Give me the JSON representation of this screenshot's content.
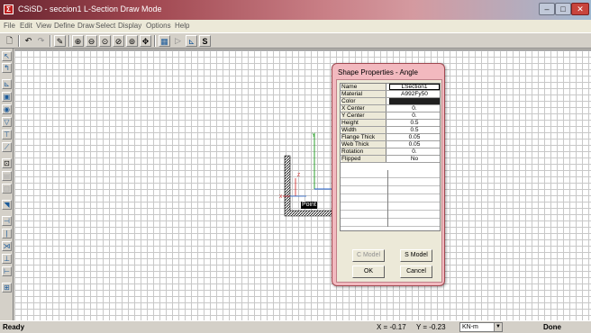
{
  "window": {
    "title": "CSiSD - seccion1  L-Section Draw Mode",
    "app_icon": "csi-app-icon"
  },
  "menu": [
    "File",
    "Edit",
    "View",
    "Define",
    "Draw",
    "Select",
    "Display",
    "Options",
    "Help"
  ],
  "toolbar": {
    "icons": [
      "new-icon",
      "undo-icon",
      "redo-icon",
      "pencil-icon",
      "zoom-in-icon",
      "zoom-out-icon",
      "zoom-window-icon",
      "zoom-previous-icon",
      "zoom-restore-icon",
      "pan-icon",
      "grid-icon",
      "reshape-icon",
      "properties-icon",
      "section-icon"
    ],
    "section_label": "S"
  },
  "left_toolbar": {
    "icons": [
      "pointer-icon",
      "reshape-pointer-icon",
      "draw-polygon-icon",
      "draw-rectangle-icon",
      "draw-circle-icon",
      "draw-triangle-icon",
      "draw-t-shape-icon",
      "draw-line-icon",
      "draw-angle-icon",
      "draw-channel-icon",
      "draw-box-icon",
      "draw-rebar-icon",
      "snap-points-icon",
      "snap-ends-icon",
      "snap-intersection-icon",
      "snap-perpendicular-icon",
      "snap-lines-icon",
      "snap-grid-icon"
    ]
  },
  "dialog": {
    "title": "Shape Properties - Angle",
    "properties": [
      {
        "name": "Name",
        "value": "LSection1"
      },
      {
        "name": "Material",
        "value": "A992Fy50"
      },
      {
        "name": "Color",
        "value": ""
      },
      {
        "name": "X Center",
        "value": "0."
      },
      {
        "name": "Y Center",
        "value": "0."
      },
      {
        "name": "Height",
        "value": "0.5"
      },
      {
        "name": "Width",
        "value": "0.5"
      },
      {
        "name": "Flange Thick",
        "value": "0.05"
      },
      {
        "name": "Web Thick",
        "value": "0.05"
      },
      {
        "name": "Rotation",
        "value": "0."
      },
      {
        "name": "Flipped",
        "value": "No"
      }
    ],
    "color_value": "#202020",
    "buttons": {
      "c_model": "C Model",
      "s_model": "S Model",
      "ok": "OK",
      "cancel": "Cancel"
    }
  },
  "canvas": {
    "point_label": "Point",
    "axis_y_label": "Y",
    "axis_z_label": "Z",
    "axis_x_label": "X"
  },
  "status": {
    "ready": "Ready",
    "x_coord": "X = -0.17",
    "y_coord": "Y = -0.23",
    "units": "KN-m",
    "done": "Done"
  }
}
